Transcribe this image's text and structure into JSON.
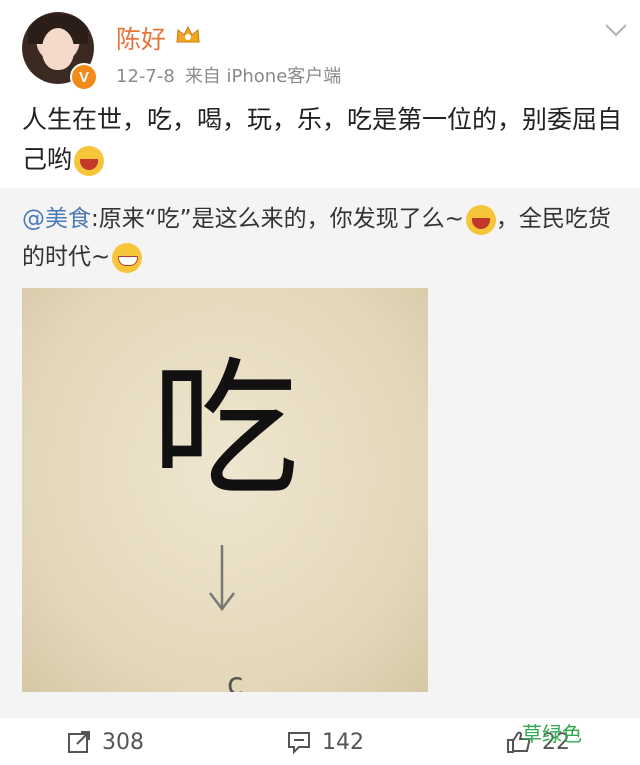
{
  "header": {
    "username": "陈好",
    "date": "12-7-8",
    "source": "来自 iPhone客户端",
    "verified_badge": "V"
  },
  "post": {
    "text": "人生在世，吃，喝，玩，乐，吃是第一位的，别委屈自己哟"
  },
  "repost": {
    "mention": "@美食",
    "text_part1": ":原来“吃”是这么来的，你发现了么~",
    "text_part2": "，全民吃货的时代~",
    "image": {
      "big_char": "吃",
      "partial_char": "c"
    }
  },
  "footer": {
    "repost_count": "308",
    "comment_count": "142",
    "like_count": "22",
    "watermark": "草绿色"
  },
  "icons": {
    "crown": "crown-icon",
    "chevron": "chevron-down-icon",
    "repost": "share-icon",
    "comment": "comment-icon",
    "like": "thumbs-up-icon"
  },
  "colors": {
    "username": "#e8753a",
    "mention": "#4a7ab5",
    "watermark": "#2fa84f",
    "badge": "#f08a1a"
  }
}
